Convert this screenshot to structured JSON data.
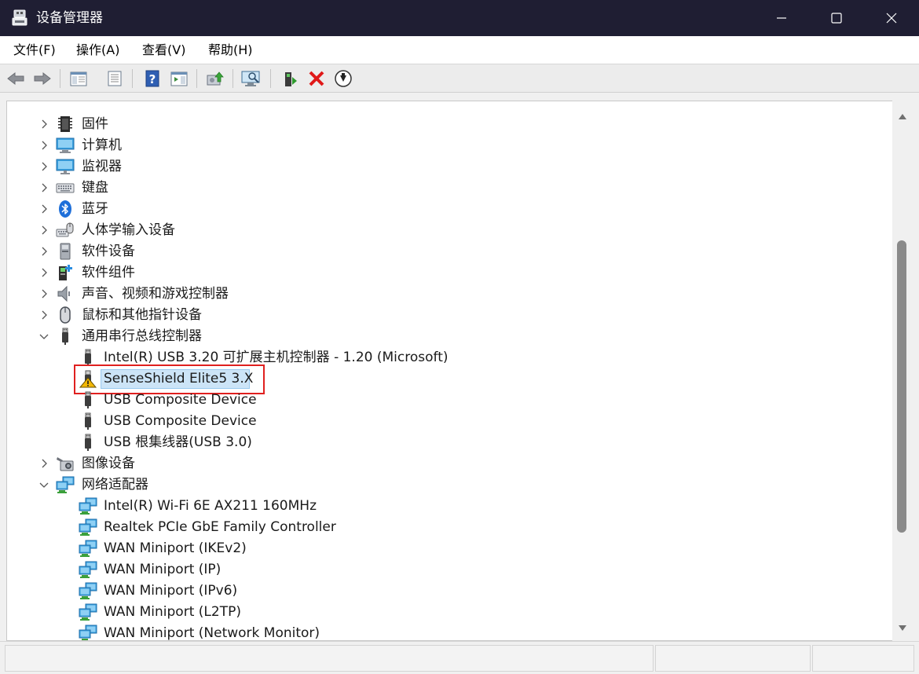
{
  "window": {
    "title": "设备管理器"
  },
  "menu": [
    "文件(F)",
    "操作(A)",
    "查看(V)",
    "帮助(H)"
  ],
  "toolbar": [
    "back-icon",
    "forward-icon",
    "show-hide-console-tree-icon",
    "properties-icon",
    "help-icon",
    "action-pane-icon",
    "update-driver-icon",
    "scan-hardware-changes-icon",
    "enable-device-icon",
    "uninstall-device-icon",
    "disable-device-icon"
  ],
  "tree": [
    {
      "label": "固件",
      "expanded": false,
      "icon": "firmware-icon"
    },
    {
      "label": "计算机",
      "expanded": false,
      "icon": "computer-icon"
    },
    {
      "label": "监视器",
      "expanded": false,
      "icon": "monitor-icon"
    },
    {
      "label": "键盘",
      "expanded": false,
      "icon": "keyboard-icon"
    },
    {
      "label": "蓝牙",
      "expanded": false,
      "icon": "bluetooth-icon"
    },
    {
      "label": "人体学输入设备",
      "expanded": false,
      "icon": "hid-icon"
    },
    {
      "label": "软件设备",
      "expanded": false,
      "icon": "software-device-icon"
    },
    {
      "label": "软件组件",
      "expanded": false,
      "icon": "software-component-icon"
    },
    {
      "label": "声音、视频和游戏控制器",
      "expanded": false,
      "icon": "speaker-icon"
    },
    {
      "label": "鼠标和其他指针设备",
      "expanded": false,
      "icon": "mouse-icon"
    },
    {
      "label": "通用串行总线控制器",
      "expanded": true,
      "icon": "usb-icon",
      "children": [
        {
          "label": "Intel(R) USB 3.20 可扩展主机控制器 - 1.20 (Microsoft)",
          "icon": "usb-icon"
        },
        {
          "label": "SenseShield Elite5 3.X",
          "icon": "usb-warning-icon",
          "selected": true,
          "warning": true
        },
        {
          "label": "USB Composite Device",
          "icon": "usb-icon"
        },
        {
          "label": "USB Composite Device",
          "icon": "usb-icon"
        },
        {
          "label": "USB 根集线器(USB 3.0)",
          "icon": "usb-icon"
        }
      ]
    },
    {
      "label": "图像设备",
      "expanded": false,
      "icon": "camera-icon"
    },
    {
      "label": "网络适配器",
      "expanded": true,
      "icon": "network-adapter-icon",
      "children": [
        {
          "label": "Intel(R) Wi-Fi 6E AX211 160MHz",
          "icon": "network-adapter-icon"
        },
        {
          "label": "Realtek PCIe GbE Family Controller",
          "icon": "network-adapter-icon"
        },
        {
          "label": "WAN Miniport (IKEv2)",
          "icon": "network-adapter-icon"
        },
        {
          "label": "WAN Miniport (IP)",
          "icon": "network-adapter-icon"
        },
        {
          "label": "WAN Miniport (IPv6)",
          "icon": "network-adapter-icon"
        },
        {
          "label": "WAN Miniport (L2TP)",
          "icon": "network-adapter-icon"
        },
        {
          "label": "WAN Miniport (Network Monitor)",
          "icon": "network-adapter-icon"
        }
      ]
    }
  ],
  "colors": {
    "titlebar": "#1f1e33",
    "selection": "#cce4f7",
    "highlight_border": "#e0201f",
    "warning": "#f2b705"
  }
}
